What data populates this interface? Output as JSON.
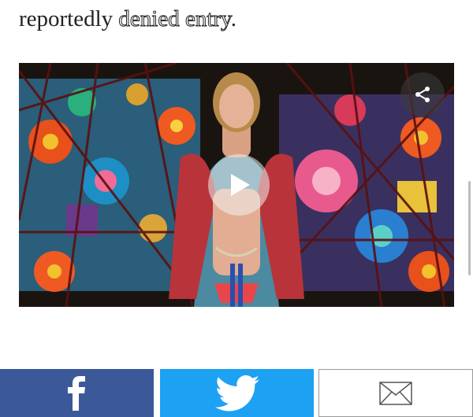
{
  "article": {
    "text_before": "reportedly ",
    "link_text": "denied entry",
    "text_after": "."
  },
  "video": {
    "share_icon": "share-icon",
    "play_icon": "play-icon"
  },
  "social": {
    "facebook_icon": "facebook-icon",
    "twitter_icon": "twitter-icon",
    "email_icon": "email-icon",
    "colors": {
      "facebook": "#3b5998",
      "twitter": "#1da1f2",
      "email_border": "#999999"
    }
  }
}
